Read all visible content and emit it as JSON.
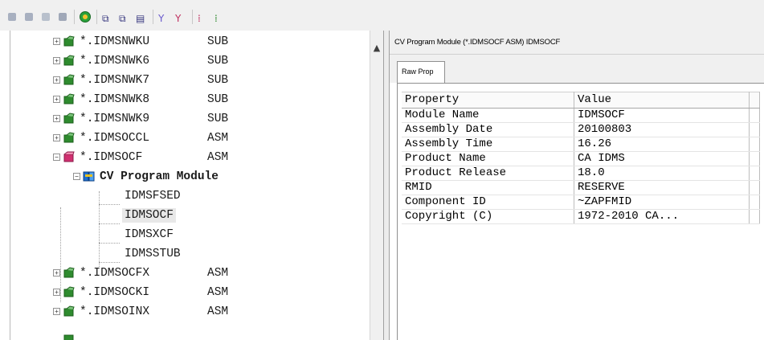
{
  "toolbar": {
    "icons": [
      "stop-icon",
      "stop-icon",
      "tree-view-icon",
      "list-view-icon",
      "globe-refresh-icon",
      "copy-icon",
      "paste-icon",
      "properties-icon",
      "filter-icon",
      "filter-clear-icon",
      "expand-icon",
      "collapse-icon"
    ]
  },
  "tree": {
    "rows": [
      {
        "name": "*.IDMSNWKU",
        "type": "SUB"
      },
      {
        "name": "*.IDMSNWK6",
        "type": "SUB"
      },
      {
        "name": "*.IDMSNWK7",
        "type": "SUB"
      },
      {
        "name": "*.IDMSNWK8",
        "type": "SUB"
      },
      {
        "name": "*.IDMSNWK9",
        "type": "SUB"
      },
      {
        "name": "*.IDMSOCCL",
        "type": "ASM"
      },
      {
        "name": "*.IDMSOCF",
        "type": "ASM"
      },
      {
        "name": "CV Program Module",
        "type": ""
      },
      {
        "name": "IDMSFSED",
        "type": ""
      },
      {
        "name": "IDMSOCF",
        "type": ""
      },
      {
        "name": "IDMSXCF",
        "type": ""
      },
      {
        "name": "IDMSSTUB",
        "type": ""
      },
      {
        "name": "*.IDMSOCFX",
        "type": "ASM"
      },
      {
        "name": "*.IDMSOCKI",
        "type": "ASM"
      },
      {
        "name": "*.IDMSOINX",
        "type": "ASM"
      }
    ]
  },
  "details": {
    "title": "CV Program Module (*.IDMSOCF  ASM) IDMSOCF",
    "tab_label": "Raw Prop",
    "columns": [
      "Property",
      "Value"
    ],
    "rows": [
      {
        "property": "Module Name",
        "value": "IDMSOCF"
      },
      {
        "property": "Assembly Date",
        "value": "20100803"
      },
      {
        "property": "Assembly Time",
        "value": "16.26"
      },
      {
        "property": "Product Name",
        "value": "CA IDMS"
      },
      {
        "property": "Product Release",
        "value": "18.0"
      },
      {
        "property": "RMID",
        "value": "RESERVE"
      },
      {
        "property": "Component ID",
        "value": "~ZAPFMID"
      },
      {
        "property": "Copyright (C)",
        "value": "1972-2010 CA..."
      }
    ]
  },
  "colors": {
    "module_icon_green": "#2e8b2e",
    "module_icon_open_pink": "#d03070",
    "cv_icon_blue": "#1e6fd0",
    "selection_bg": "#e8e8e8"
  }
}
